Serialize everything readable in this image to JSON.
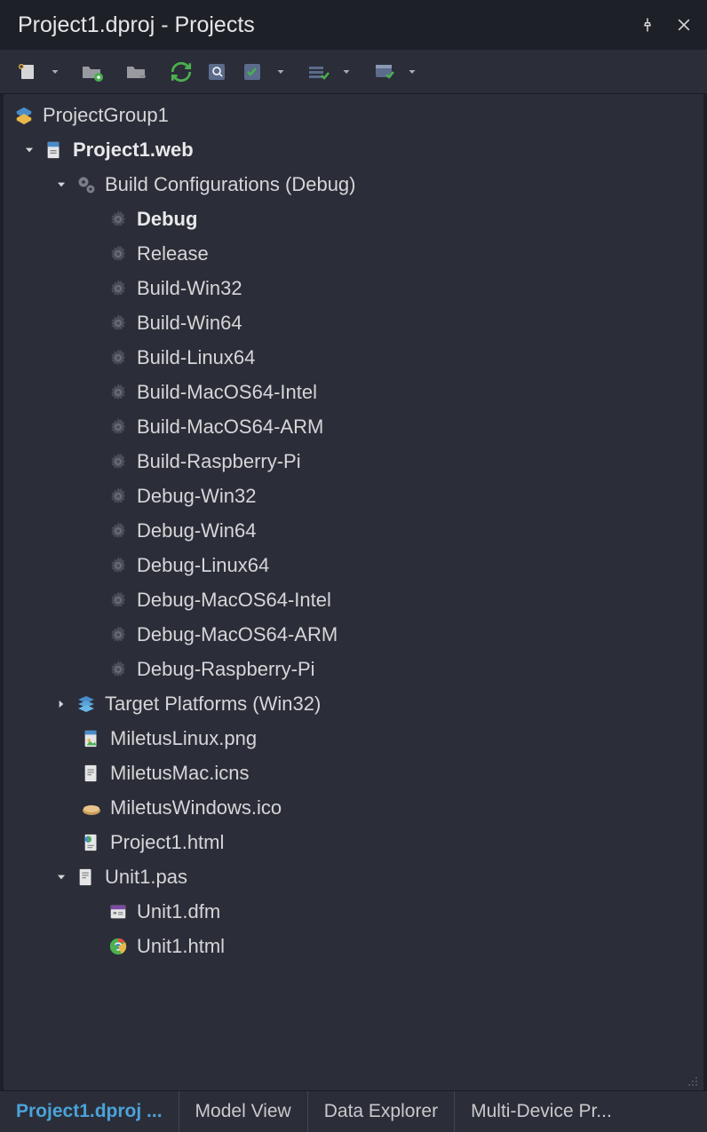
{
  "title": "Project1.dproj - Projects",
  "tree": {
    "root": "ProjectGroup1",
    "project": "Project1.web",
    "buildConfigs": {
      "label": "Build Configurations (Debug)",
      "active": "Debug",
      "items": [
        "Debug",
        "Release",
        "Build-Win32",
        "Build-Win64",
        "Build-Linux64",
        "Build-MacOS64-Intel",
        "Build-MacOS64-ARM",
        "Build-Raspberry-Pi",
        "Debug-Win32",
        "Debug-Win64",
        "Debug-Linux64",
        "Debug-MacOS64-Intel",
        "Debug-MacOS64-ARM",
        "Debug-Raspberry-Pi"
      ]
    },
    "targetPlatforms": "Target Platforms (Win32)",
    "files": [
      "MiletusLinux.png",
      "MiletusMac.icns",
      "MiletusWindows.ico",
      "Project1.html"
    ],
    "unit": {
      "name": "Unit1.pas",
      "children": [
        "Unit1.dfm",
        "Unit1.html"
      ]
    }
  },
  "footerTabs": [
    "Project1.dproj ...",
    "Model View",
    "Data Explorer",
    "Multi-Device Pr..."
  ],
  "activeFooterTab": 0
}
